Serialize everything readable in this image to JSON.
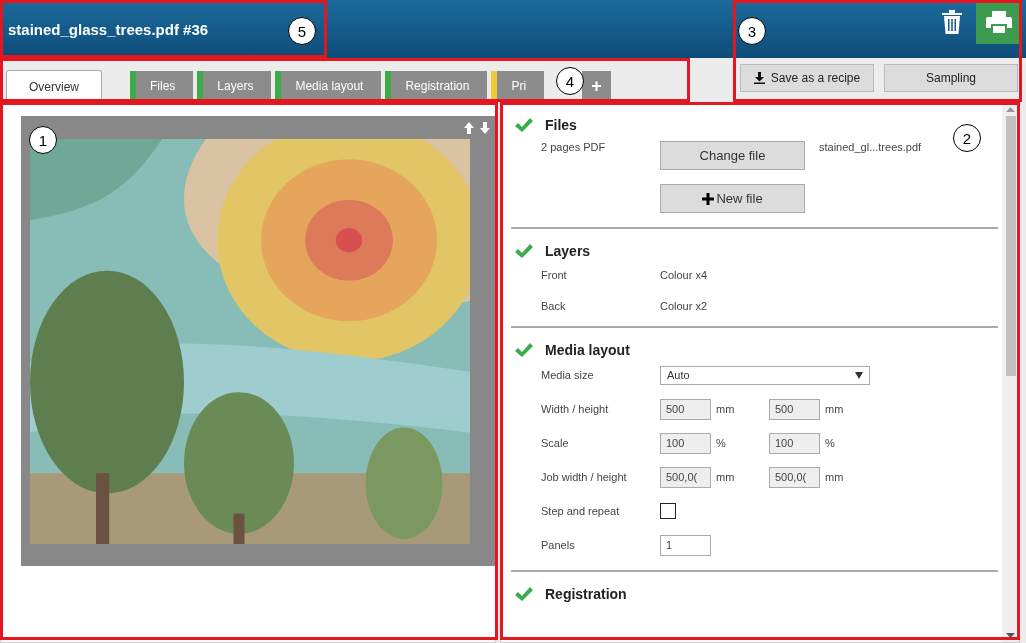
{
  "header": {
    "title": "stained_glass_trees.pdf #36"
  },
  "tabs": [
    {
      "label": "Overview",
      "selected": true
    },
    {
      "label": "Files",
      "selected": false,
      "color": "#3cab4a"
    },
    {
      "label": "Layers",
      "selected": false,
      "color": "#3cab4a"
    },
    {
      "label": "Media layout",
      "selected": false,
      "color": "#3cab4a"
    },
    {
      "label": "Registration",
      "selected": false,
      "color": "#3cab4a"
    },
    {
      "label": "Pri",
      "selected": false,
      "color": "#f2c835"
    }
  ],
  "add_tab": {
    "label": "+"
  },
  "actions": [
    {
      "label": "Save as a recipe",
      "kind": "download"
    },
    {
      "label": "Sampling",
      "kind": "plain"
    }
  ],
  "sections": [
    {
      "kind": "files",
      "title": "Files",
      "done": true,
      "info": "2 pages PDF",
      "filename": "stained_gl...trees.pdf",
      "buttons": [
        {
          "label": "Change file",
          "kind": "plain"
        },
        {
          "label": "New file",
          "kind": "add"
        }
      ]
    },
    {
      "kind": "rows",
      "title": "Layers",
      "done": true,
      "rows": [
        {
          "label": "Front",
          "value": "Colour x4"
        },
        {
          "label": "Back",
          "value": "Colour x2"
        }
      ]
    },
    {
      "kind": "form",
      "title": "Media layout",
      "done": true,
      "fields": [
        {
          "kind": "select",
          "label": "Media size",
          "value": "Auto"
        },
        {
          "kind": "pair",
          "label": "Width / height",
          "values": [
            "500",
            "500"
          ],
          "units": [
            "mm",
            "mm"
          ]
        },
        {
          "kind": "pair",
          "label": "Scale",
          "values": [
            "100",
            "100"
          ],
          "units": [
            "%",
            "%"
          ]
        },
        {
          "kind": "pair",
          "label": "Job width / height",
          "values": [
            "500,0(",
            "500,0("
          ],
          "units": [
            "mm",
            "mm"
          ]
        },
        {
          "kind": "checkbox",
          "label": "Step and repeat",
          "checked": false
        },
        {
          "kind": "input",
          "label": "Panels",
          "value": "1"
        }
      ]
    },
    {
      "kind": "title",
      "title": "Registration",
      "done": true
    }
  ],
  "callouts": [
    {
      "number": "5"
    },
    {
      "number": "3"
    },
    {
      "number": "4"
    },
    {
      "number": "1"
    },
    {
      "number": "2"
    }
  ]
}
